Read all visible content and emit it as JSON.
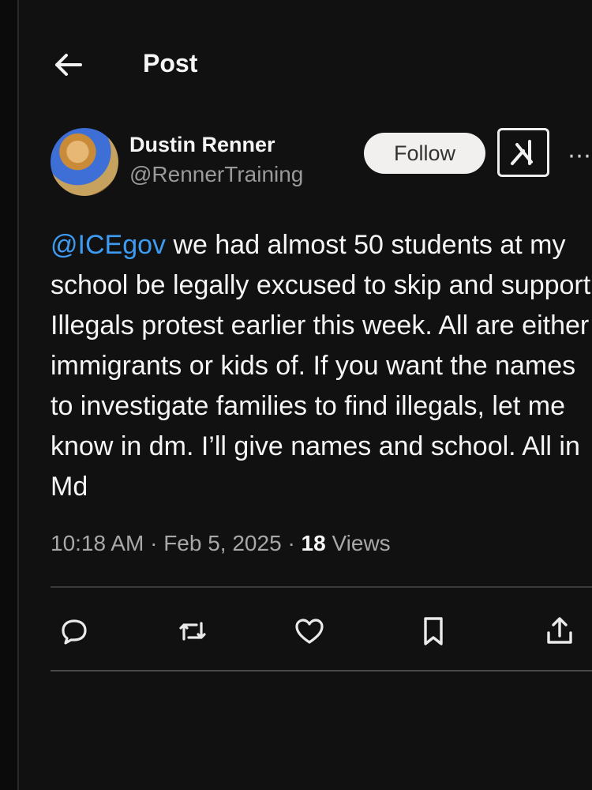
{
  "header": {
    "back_icon": "arrow-left-icon",
    "title": "Post"
  },
  "author": {
    "display_name": "Dustin Renner",
    "handle": "@RennerTraining",
    "follow_label": "Follow",
    "grok_icon": "grok-icon",
    "more_icon": "more-horizontal-icon"
  },
  "tweet": {
    "mention": "@ICEgov",
    "text": " we had almost 50 students at my school be legally excused to skip and support Illegals protest earlier this week. All are either immigrants or kids of. If you want the names to investigate families to find illegals, let me know in dm. I’ll give names and school. All in Md"
  },
  "meta": {
    "time": "10:18 AM",
    "date": "Feb 5, 2025",
    "views_count": "18",
    "views_label": "Views"
  },
  "actions": [
    {
      "name": "reply",
      "icon": "reply-icon"
    },
    {
      "name": "repost",
      "icon": "repost-icon"
    },
    {
      "name": "like",
      "icon": "heart-icon"
    },
    {
      "name": "bookmark",
      "icon": "bookmark-icon"
    },
    {
      "name": "share",
      "icon": "share-icon"
    }
  ],
  "colors": {
    "background": "#111112",
    "mention": "#3d9bf2",
    "follow_button": "#f2f0ee"
  }
}
